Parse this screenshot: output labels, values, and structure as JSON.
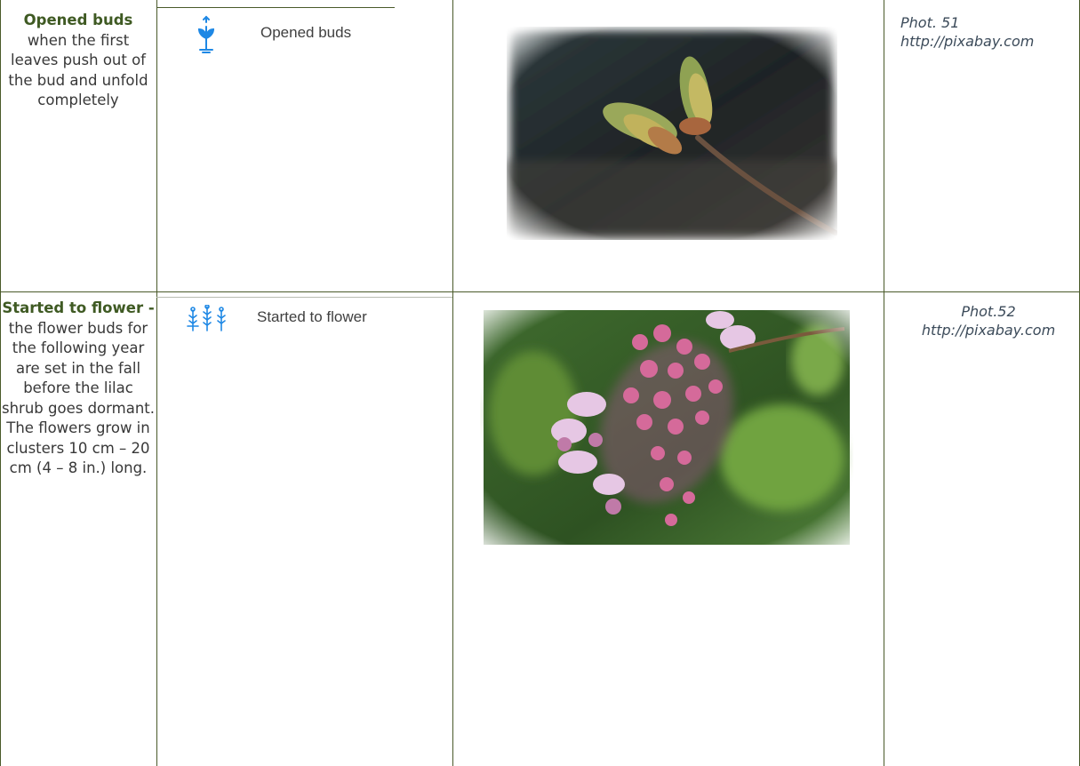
{
  "rows": [
    {
      "term": "Opened buds",
      "description": " when the first leaves push out of the bud and unfold completely",
      "phase_label": "Opened buds",
      "phase_icon": "seedling-sprout-icon",
      "photo_subject": "lilac-leaf-bud-photo",
      "caption_number": "Phot. 51",
      "caption_source": "http://pixabay.com"
    },
    {
      "term": "Started to flower - ",
      "description": "the flower buds for the following year are set in the fall before the lilac shrub goes dormant. The flowers grow in clusters 10 cm – 20 cm (4 – 8 in.) long.",
      "phase_label": "Started to flower",
      "phase_icon": "flowering-stalks-icon",
      "photo_subject": "lilac-flower-cluster-photo",
      "caption_number": "Phot.52",
      "caption_source": "http://pixabay.com"
    }
  ],
  "colors": {
    "border": "#4a5a2a",
    "term_text": "#3f5a23",
    "icon_blue": "#1e88e5",
    "caption_text": "#3c4b5a"
  }
}
